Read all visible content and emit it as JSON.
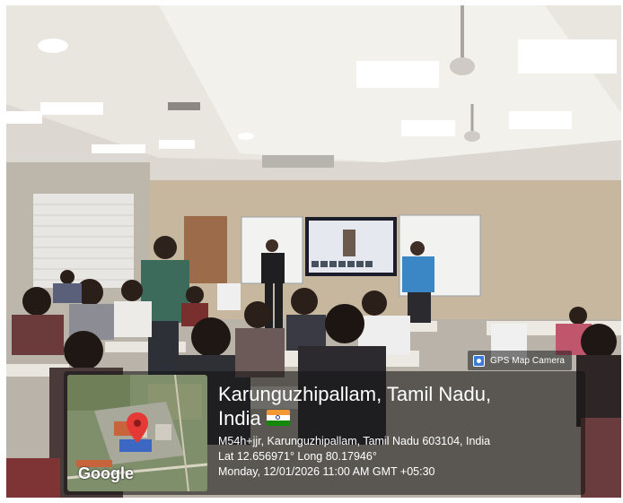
{
  "stamp": {
    "app_label": "GPS Map Camera",
    "place": "Karunguzhipallam, Tamil Nadu,",
    "country": "India",
    "flag_icon": "india-flag-icon",
    "address": "M54h+jjr, Karunguzhipallam, Tamil Nadu 603104, India",
    "coords": "Lat 12.656971° Long 80.17946°",
    "datetime": "Monday, 12/01/2026 11:00 AM GMT +05:30",
    "map_brand": "Google",
    "pin_color": "#e53935"
  }
}
